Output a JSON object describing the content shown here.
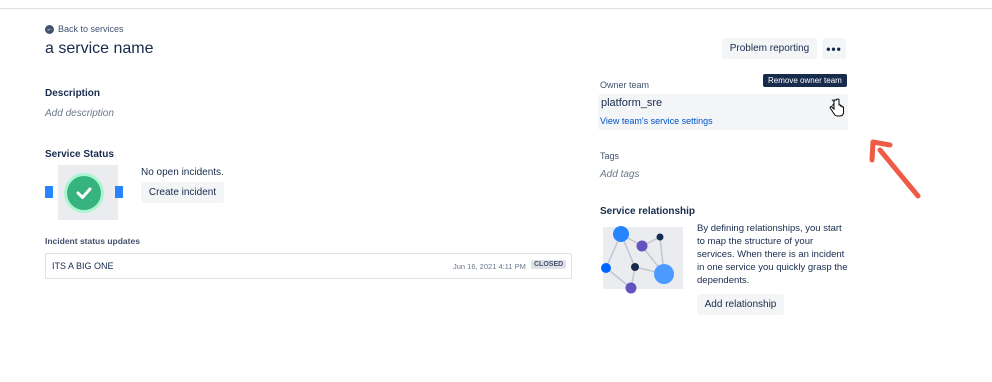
{
  "header": {
    "back_label": "Back to services",
    "title": "a service name",
    "problem_reporting_label": "Problem reporting",
    "more_label": "•••"
  },
  "description": {
    "heading": "Description",
    "placeholder": "Add description"
  },
  "service_status": {
    "heading": "Service Status",
    "status_text": "No open incidents.",
    "create_incident_label": "Create incident"
  },
  "incident_updates": {
    "heading": "Incident status updates",
    "items": [
      {
        "title": "ITS A BIG ONE",
        "date": "Jun 16, 2021 4:11 PM",
        "status": "CLOSED"
      }
    ]
  },
  "owner_team": {
    "heading": "Owner team",
    "tooltip": "Remove owner team",
    "team_name": "platform_sre",
    "link_label": "View team's service settings"
  },
  "tags": {
    "heading": "Tags",
    "placeholder": "Add tags"
  },
  "service_relationship": {
    "heading": "Service relationship",
    "description": "By defining relationships, you start to map the structure of your services. When there is an incident in one service you quickly grasp the dependents.",
    "add_label": "Add relationship"
  },
  "colors": {
    "accent": "#0052cc",
    "success": "#36b37e",
    "annotation_arrow": "#ef5b45"
  }
}
